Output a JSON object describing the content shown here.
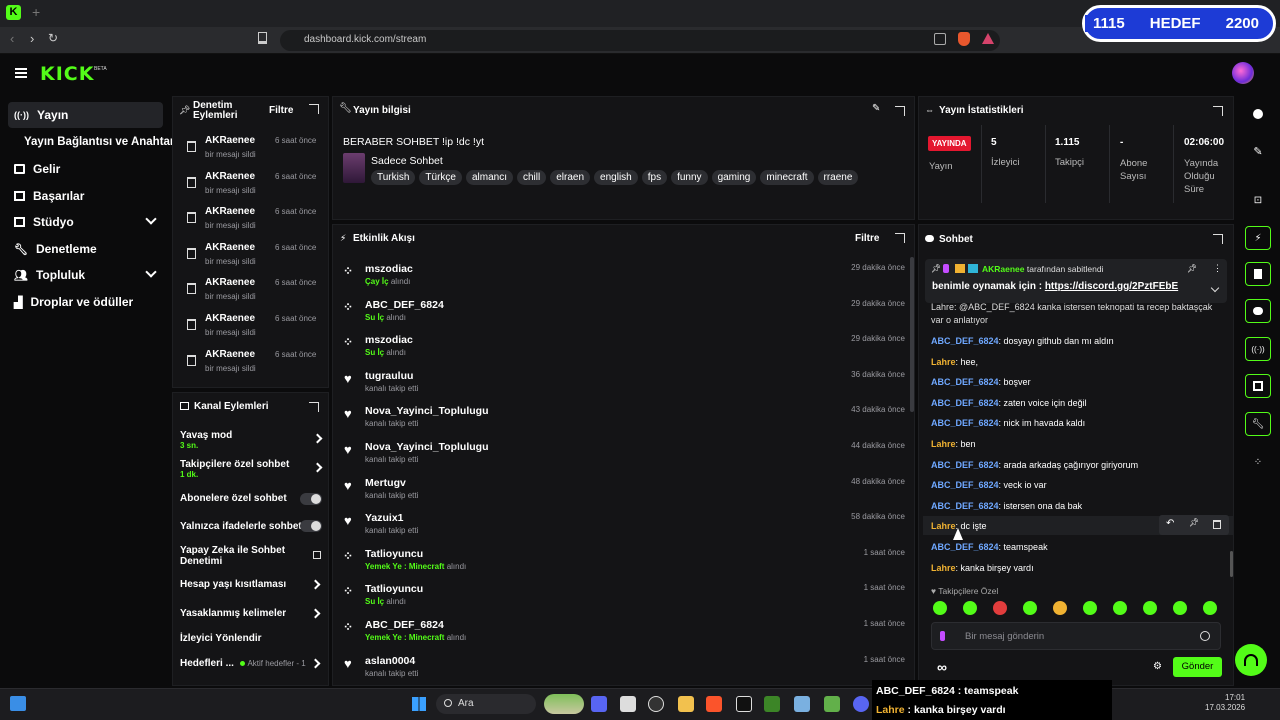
{
  "browser": {
    "url": "dashboard.kick.com/stream"
  },
  "goal": {
    "current": "1115",
    "label": "HEDEF",
    "target": "2200"
  },
  "brand": {
    "logo": "KICK",
    "beta": "BETA"
  },
  "sidebar": {
    "items": [
      {
        "label": "Yayın"
      },
      {
        "label": "Yayın Bağlantısı ve Anahtarı"
      },
      {
        "label": "Gelir"
      },
      {
        "label": "Başarılar"
      },
      {
        "label": "Stüdyo"
      },
      {
        "label": "Denetleme"
      },
      {
        "label": "Topluluk"
      },
      {
        "label": "Droplar ve ödüller"
      }
    ]
  },
  "mod_log": {
    "title_l1": "Denetim",
    "title_l2": "Eylemleri",
    "filter": "Filtre",
    "items": [
      {
        "user": "AKRaenee",
        "time": "6 saat önce",
        "action": "bir mesajı sildi"
      },
      {
        "user": "AKRaenee",
        "time": "6 saat önce",
        "action": "bir mesajı sildi"
      },
      {
        "user": "AKRaenee",
        "time": "6 saat önce",
        "action": "bir mesajı sildi"
      },
      {
        "user": "AKRaenee",
        "time": "6 saat önce",
        "action": "bir mesajı sildi"
      },
      {
        "user": "AKRaenee",
        "time": "6 saat önce",
        "action": "bir mesajı sildi"
      },
      {
        "user": "AKRaenee",
        "time": "6 saat önce",
        "action": "bir mesajı sildi"
      },
      {
        "user": "AKRaenee",
        "time": "6 saat önce",
        "action": "bir mesajı sildi"
      }
    ]
  },
  "channel_actions": {
    "title": "Kanal Eylemleri",
    "slow": {
      "label": "Yavaş mod",
      "value": "3 sn."
    },
    "followers": {
      "label": "Takipçilere özel sohbet",
      "value": "1 dk."
    },
    "subs": "Abonelere özel sohbet",
    "emotes": "Yalnızca ifadelerle sohbet",
    "ai_l1": "Yapay Zeka ile Sohbet",
    "ai_l2": "Denetimi",
    "age": "Hesap yaşı kısıtlaması",
    "banned": "Yasaklanmış kelimeler",
    "redirect": "İzleyici Yönlendir",
    "goals": "Hedefleri ...",
    "goals_status": "Aktif hedefler - 1"
  },
  "stream_info": {
    "title": "Yayın bilgisi",
    "stream_title": "BERABER SOHBET !ip !dc !yt",
    "category": "Sadece Sohbet",
    "tags": [
      "Turkish",
      "Türkçe",
      "almancı",
      "chill",
      "elraen",
      "english",
      "fps",
      "funny",
      "gaming",
      "minecraft",
      "rraene"
    ]
  },
  "activity": {
    "title": "Etkinlik Akışı",
    "filter": "Filtre",
    "items": [
      {
        "kind": "redeem",
        "user": "mszodiac",
        "reward": "Çay İç",
        "suffix": "alındı",
        "time": "29 dakika önce"
      },
      {
        "kind": "redeem",
        "user": "ABC_DEF_6824",
        "reward": "Su İç",
        "suffix": "alındı",
        "time": "29 dakika önce"
      },
      {
        "kind": "redeem",
        "user": "mszodiac",
        "reward": "Su İç",
        "suffix": "alındı",
        "time": "29 dakika önce"
      },
      {
        "kind": "follow",
        "user": "tugrauluu",
        "reward": "",
        "suffix": "kanalı takip etti",
        "time": "36 dakika önce"
      },
      {
        "kind": "follow",
        "user": "Nova_Yayinci_Toplulugu",
        "reward": "",
        "suffix": "kanalı takip etti",
        "time": "43 dakika önce"
      },
      {
        "kind": "follow",
        "user": "Nova_Yayinci_Toplulugu",
        "reward": "",
        "suffix": "kanalı takip etti",
        "time": "44 dakika önce"
      },
      {
        "kind": "follow",
        "user": "Mertugv",
        "reward": "",
        "suffix": "kanalı takip etti",
        "time": "48 dakika önce"
      },
      {
        "kind": "follow",
        "user": "Yazuix1",
        "reward": "",
        "suffix": "kanalı takip etti",
        "time": "58 dakika önce"
      },
      {
        "kind": "redeem",
        "user": "Tatlioyuncu",
        "reward": "Yemek Ye : Minecraft",
        "suffix": "alındı",
        "time": "1 saat önce"
      },
      {
        "kind": "redeem",
        "user": "Tatlioyuncu",
        "reward": "Su İç",
        "suffix": "alındı",
        "time": "1 saat önce"
      },
      {
        "kind": "redeem",
        "user": "ABC_DEF_6824",
        "reward": "Yemek Ye : Minecraft",
        "suffix": "alındı",
        "time": "1 saat önce"
      },
      {
        "kind": "follow",
        "user": "aslan0004",
        "reward": "",
        "suffix": "kanalı takip etti",
        "time": "1 saat önce"
      }
    ]
  },
  "stats": {
    "title": "Yayın İstatistikleri",
    "live_badge": "YAYINDA",
    "live_label": "Yayın",
    "viewers": {
      "value": "5",
      "label": "İzleyici"
    },
    "followers": {
      "value": "1.115",
      "label": "Takipçi"
    },
    "subs": {
      "value": "-",
      "label_l1": "Abone",
      "label_l2": "Sayısı"
    },
    "uptime": {
      "value": "02:06:00",
      "label_l1": "Yayında",
      "label_l2": "Olduğu",
      "label_l3": "Süre"
    }
  },
  "chat": {
    "title": "Sohbet",
    "pinned_by": "AKRaenee",
    "pinned_suffix": "tarafından sabitlendi",
    "pinned_text": "benimle oynamak için :",
    "pinned_link": "https://discord.gg/2PztFEbE",
    "partial_l1": "Lahre: @ABC_DEF_6824 kanka istersen teknopati ta recep baktaşçak",
    "partial_l2": "var o anlatıyor",
    "messages": [
      {
        "user": "ABC_DEF_6824",
        "color": "b",
        "text": "dosyayı github dan mı aldın"
      },
      {
        "user": "Lahre",
        "color": "o",
        "text": "hee,"
      },
      {
        "user": "ABC_DEF_6824",
        "color": "b",
        "text": "boşver"
      },
      {
        "user": "ABC_DEF_6824",
        "color": "b",
        "text": "zaten voice için değil"
      },
      {
        "user": "ABC_DEF_6824",
        "color": "b",
        "text": "nick im havada kaldı"
      },
      {
        "user": "Lahre",
        "color": "o",
        "text": "ben"
      },
      {
        "user": "ABC_DEF_6824",
        "color": "b",
        "text": "arada arkadaş çağırıyor giriyorum"
      },
      {
        "user": "ABC_DEF_6824",
        "color": "b",
        "text": "veck io var"
      },
      {
        "user": "ABC_DEF_6824",
        "color": "b",
        "text": "istersen ona da bak"
      },
      {
        "user": "Lahre",
        "color": "o",
        "text": "dc işte"
      },
      {
        "user": "ABC_DEF_6824",
        "color": "b",
        "text": "teamspeak"
      },
      {
        "user": "Lahre",
        "color": "o",
        "text": "kanka birşey vardı"
      }
    ],
    "emote_header": "Takipçilere Özel",
    "input_placeholder": "Bir mesaj gönderin",
    "send": "Gönder"
  },
  "overlay": {
    "l1_user": "ABC_DEF_6824",
    "l1_text": "teamspeak",
    "l2_user": "Lahre",
    "l2_text": "kanka birşey vardı"
  },
  "taskbar": {
    "search": "Ara",
    "time": "17:01",
    "date": "17.03.2026"
  }
}
